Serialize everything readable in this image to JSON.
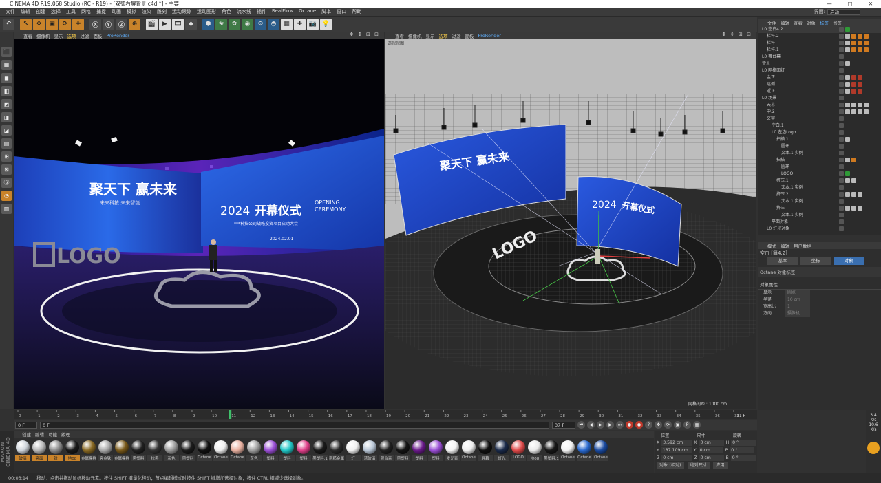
{
  "window": {
    "title": "CINEMA 4D R19.068 Studio (RC - R19) - [双弧右屏背景.c4d *] - 主要",
    "controls": [
      "—",
      "□",
      "✕"
    ]
  },
  "menubar": {
    "items": [
      "文件",
      "编辑",
      "创建",
      "选择",
      "工具",
      "网格",
      "捕捉",
      "动画",
      "模拟",
      "渲染",
      "雕刻",
      "运动跟踪",
      "运动图形",
      "角色",
      "流水线",
      "插件",
      "RealFlow",
      "Octane",
      "脚本",
      "窗口",
      "帮助"
    ],
    "layout_label": "界面:",
    "layout_value": "启动"
  },
  "toolbar": {
    "buttons": [
      "↶",
      "↖",
      "✥",
      "▣",
      "⟳",
      "✚",
      "Ⓧ",
      "Ⓨ",
      "Ⓩ",
      "⊕",
      "🎬",
      "▶",
      "🎞",
      "◆",
      "⬢",
      "❀",
      "✿",
      "◉",
      "⚙",
      "◓",
      "▦",
      "✚",
      "📷",
      "💡"
    ]
  },
  "lefttools": [
    "⬛",
    "▦",
    "◼",
    "◧",
    "◩",
    "◨",
    "◪",
    "▤",
    "⊞",
    "⊠",
    "Ⓢ",
    "◔",
    "▥"
  ],
  "viewport_left": {
    "menu": [
      "查看",
      "摄像机",
      "显示",
      "选项",
      "过滤",
      "面板",
      "ProRender"
    ],
    "icons": "✥ ↕ ⊞ ⊡",
    "screen_left_big": "聚天下 赢未来",
    "screen_left_small": "未来科技 未来智能",
    "screen_right_year": "2024",
    "screen_right_title": "开幕仪式",
    "screen_right_en1": "OPENING",
    "screen_right_en2": "CEREMONY",
    "screen_right_sub": "***科技公司战略投资项目启动大会",
    "screen_right_date": "2024.02.01",
    "logo_text": "LOGO"
  },
  "viewport_right": {
    "menu": [
      "查看",
      "摄像机",
      "显示",
      "选项",
      "过滤",
      "面板",
      "ProRender"
    ],
    "icons": "✥ ↕ ⊞ ⊡",
    "header_label": "透视视图",
    "screen_left_big": "聚天下 赢未来",
    "screen_right_year": "2024",
    "screen_right_title": "开幕仪式",
    "logo_text": "LOGO",
    "grid_info": "网格间距 : 1000 cm"
  },
  "object_manager": {
    "tabs": [
      "文件",
      "编辑",
      "查看",
      "对象",
      "标签",
      "书签"
    ],
    "active_tab": "标签",
    "rows": [
      {
        "indent": 0,
        "name": "L0 空白4.2",
        "tags": [
          "g"
        ]
      },
      {
        "indent": 1,
        "name": "栏杆.2",
        "tags": [
          "w",
          "o",
          "o",
          "o"
        ]
      },
      {
        "indent": 1,
        "name": "栏杆",
        "tags": [
          "w",
          "o",
          "o",
          "o"
        ]
      },
      {
        "indent": 1,
        "name": "栏杆.1",
        "tags": [
          "w",
          "o",
          "o",
          "o"
        ]
      },
      {
        "indent": 0,
        "name": "L0 舞台幕",
        "tags": []
      },
      {
        "indent": 0,
        "name": "背景",
        "tags": [
          "w"
        ]
      },
      {
        "indent": 0,
        "name": "L0 网格面灯",
        "tags": []
      },
      {
        "indent": 1,
        "name": "金正",
        "tags": [
          "w",
          "r",
          "r"
        ]
      },
      {
        "indent": 1,
        "name": "远侧",
        "tags": [
          "w",
          "r",
          "r"
        ]
      },
      {
        "indent": 1,
        "name": "近正",
        "tags": [
          "w",
          "r",
          "r"
        ]
      },
      {
        "indent": 0,
        "name": "L0 场景",
        "tags": []
      },
      {
        "indent": 1,
        "name": "天幕",
        "tags": [
          "w",
          "w",
          "w",
          "w"
        ]
      },
      {
        "indent": 1,
        "name": "中.2",
        "tags": [
          "w",
          "w",
          "w",
          "w"
        ]
      },
      {
        "indent": 1,
        "name": "文字",
        "tags": []
      },
      {
        "indent": 2,
        "name": "空白.1",
        "tags": []
      },
      {
        "indent": 2,
        "name": "L0 左边Logo",
        "tags": []
      },
      {
        "indent": 3,
        "name": "扫描.1",
        "tags": [
          "w"
        ]
      },
      {
        "indent": 4,
        "name": "圆环",
        "tags": []
      },
      {
        "indent": 4,
        "name": "文本.1 实例",
        "tags": []
      },
      {
        "indent": 3,
        "name": "扫描",
        "tags": [
          "w",
          "o"
        ]
      },
      {
        "indent": 4,
        "name": "圆环",
        "tags": []
      },
      {
        "indent": 4,
        "name": "LOGO",
        "tags": [
          "g"
        ]
      },
      {
        "indent": 3,
        "name": "挤压.1",
        "tags": [
          "w",
          "w"
        ]
      },
      {
        "indent": 4,
        "name": "文本.1 实例",
        "tags": []
      },
      {
        "indent": 3,
        "name": "挤压.2",
        "tags": [
          "w",
          "w",
          "w"
        ]
      },
      {
        "indent": 4,
        "name": "文本.1 实例",
        "tags": []
      },
      {
        "indent": 3,
        "name": "挤压",
        "tags": [
          "w",
          "w",
          "w"
        ]
      },
      {
        "indent": 4,
        "name": "文本.1 实例",
        "tags": []
      },
      {
        "indent": 2,
        "name": "平面对象",
        "tags": []
      },
      {
        "indent": 1,
        "name": "L0 灯光对象",
        "tags": []
      }
    ]
  },
  "attribute_manager": {
    "tabs": [
      "模式",
      "编辑",
      "用户数据"
    ],
    "object_name": "空白 [舞4.2]",
    "sub_tabs": [
      "基本",
      "坐标",
      "对象"
    ],
    "active_sub_tab": "对象",
    "octane_label": "Octane 对象标签",
    "section": "对象属性",
    "props": [
      {
        "label": "显示",
        "value": "圆点"
      },
      {
        "label": "半径",
        "value": "10 cm"
      },
      {
        "label": "宽高比",
        "value": "1"
      },
      {
        "label": "方向",
        "value": "摄像机"
      }
    ]
  },
  "timeline": {
    "ticks": [
      "0",
      "1",
      "2",
      "3",
      "4",
      "5",
      "6",
      "7",
      "8",
      "9",
      "10",
      "11",
      "12",
      "13",
      "14",
      "15",
      "16",
      "17",
      "18",
      "19",
      "20",
      "21",
      "22",
      "23",
      "24",
      "25",
      "26",
      "27",
      "28",
      "29",
      "30",
      "31",
      "32",
      "33",
      "34",
      "35",
      "36",
      "37"
    ],
    "current": "11",
    "end_label": "11 F",
    "start_field": "0 F",
    "mid_field": "0 F",
    "end_field": "37 F",
    "end_field2": "37 F"
  },
  "materials": {
    "tabs": [
      "创建",
      "编辑",
      "功能",
      "纹理"
    ],
    "items": [
      {
        "label": "玻璃",
        "color": "#d0d6dc",
        "sel": true
      },
      {
        "label": "亮面",
        "color": "#b8b8b8",
        "sel": true
      },
      {
        "label": "铁",
        "color": "#8c8c8c",
        "sel": true
      },
      {
        "label": "地08",
        "color": "#1a1a1a",
        "sel": true
      },
      {
        "label": "金属模样",
        "color": "#8a6a24"
      },
      {
        "label": "亮金铁",
        "color": "#aaaaaa"
      },
      {
        "label": "金属模样",
        "color": "#7a5a1a"
      },
      {
        "label": "黑塑料",
        "color": "#222222"
      },
      {
        "label": "抗黑",
        "color": "#333333"
      },
      {
        "label": "灰色",
        "color": "#9a9a9a"
      },
      {
        "label": "黑塑料",
        "color": "#1c1c1c"
      },
      {
        "label": "Octane",
        "color": "#111111"
      },
      {
        "label": "Octane",
        "color": "#eeeeee"
      },
      {
        "label": "Octane",
        "color": "#e8b0a0"
      },
      {
        "label": "灰色",
        "color": "#a0a0a0"
      },
      {
        "label": "塑料",
        "color": "#9b4fd6"
      },
      {
        "label": "塑料",
        "color": "#22c6c6"
      },
      {
        "label": "塑料",
        "color": "#e0408a"
      },
      {
        "label": "黑塑料.1",
        "color": "#1a1a1a"
      },
      {
        "label": "粗糙金属",
        "color": "#2a2a2a"
      },
      {
        "label": "灯",
        "color": "#f0f0f0"
      },
      {
        "label": "蓝玻璃",
        "color": "#b8c6d6"
      },
      {
        "label": "混合素",
        "color": "#222222"
      },
      {
        "label": "黑塑料",
        "color": "#141414"
      },
      {
        "label": "塑料",
        "color": "#6a1a8a"
      },
      {
        "label": "塑料",
        "color": "#9b4fd6"
      },
      {
        "label": "发光表",
        "color": "#f4f4f4"
      },
      {
        "label": "Octane",
        "color": "#eeeeee"
      },
      {
        "label": "屏幕",
        "color": "#101010"
      },
      {
        "label": "灯光",
        "color": "#1a2a4a"
      },
      {
        "label": "LOGO",
        "color": "#e04a4a"
      },
      {
        "label": "地08",
        "color": "#eaeaea"
      },
      {
        "label": "黑塑料.1",
        "color": "#181818"
      },
      {
        "label": "Octane",
        "color": "#f2f2f2"
      },
      {
        "label": "Octane",
        "color": "#2a6ad0"
      },
      {
        "label": "Octane",
        "color": "#1a4aa0"
      }
    ]
  },
  "coordinates": {
    "headers": [
      "位置",
      "尺寸",
      "旋转"
    ],
    "rows": [
      {
        "axis": "X",
        "pos": "3.592 cm",
        "size": "0 cm",
        "rot_axis": "H",
        "rot": "0 °"
      },
      {
        "axis": "Y",
        "pos": "187.109 cm",
        "size": "0 cm",
        "rot_axis": "P",
        "rot": "0 °"
      },
      {
        "axis": "Z",
        "pos": "0 cm",
        "size": "0 cm",
        "rot_axis": "B",
        "rot": "0 °"
      }
    ],
    "mode1": "对象 (相对)",
    "mode2": "绝对尺寸",
    "apply": "应用"
  },
  "status": {
    "time": "00:03:14",
    "text": "移动：点击并拖动鼠标移动元素。按住 SHIFT 键量化移动；节点编辑模式时按住 SHIFT 键增加选择对象；按住 CTRL 键减少选择对象。"
  },
  "maxon": "MAXON CINEMA 4D",
  "right_edge": {
    "v1": "3.4",
    "u1": "K/s",
    "v2": "10.6",
    "u2": "K/s"
  }
}
